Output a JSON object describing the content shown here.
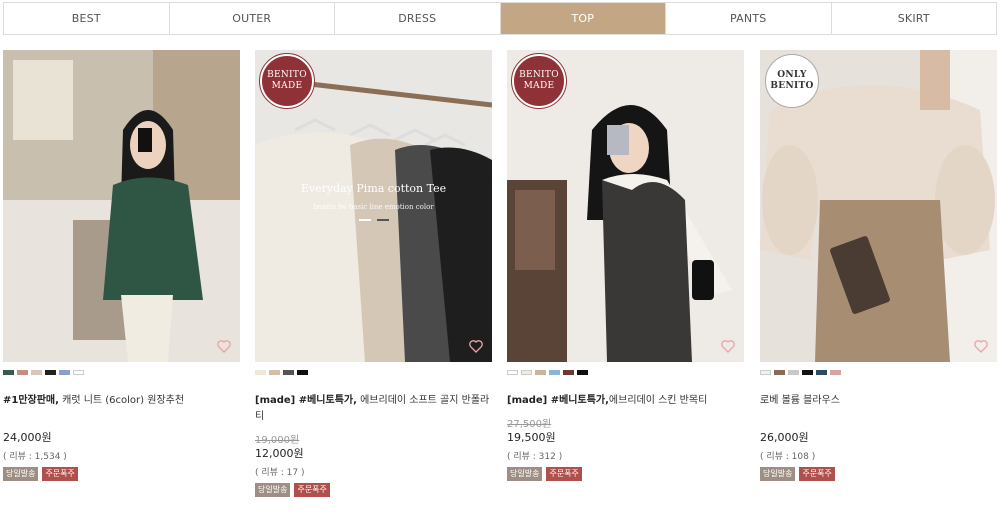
{
  "tabs": [
    {
      "label": "BEST"
    },
    {
      "label": "OUTER"
    },
    {
      "label": "DRESS"
    },
    {
      "label": "TOP",
      "active": true
    },
    {
      "label": "PANTS"
    },
    {
      "label": "SKIRT"
    }
  ],
  "products": [
    {
      "title_bold": "#1만장판매,",
      "title_rest": " 캐럿 니트 (6color) 원장추천",
      "old_price": "",
      "price": "24,000원",
      "reviews": "( 리뷰 : 1,534 )",
      "tags": [
        "당일발송",
        "주문폭주"
      ],
      "swatches": [
        "#3a5b4b",
        "#c98c80",
        "#d8c7b8",
        "#222222",
        "#8aa0c8",
        "#ffffff"
      ]
    },
    {
      "badge": [
        "BENITO",
        "MADE"
      ],
      "title_bold": "[made] #베니토특가,",
      "title_rest": " 에브리데이 소프트 골지 반폴라티",
      "old_price": "19,000원",
      "price": "12,000원",
      "reviews": "( 리뷰 : 17 )",
      "tags": [
        "당일발송",
        "주문폭주"
      ],
      "swatches": [
        "#f1e7d9",
        "#d3bfa9",
        "#555555",
        "#111111"
      ],
      "image_text": {
        "line1": "Everyday  Pima cotton Tee",
        "line2": "benito fw basic line emotion color"
      }
    },
    {
      "badge": [
        "BENITO",
        "MADE"
      ],
      "title_bold": "[made] #베니토특가,",
      "title_rest": "에브리데이 스킨 반목티",
      "old_price": "27,500원",
      "price": "19,500원",
      "reviews": "( 리뷰 : 312 )",
      "tags": [
        "당일발송",
        "주문폭주"
      ],
      "swatches": [
        "#ffffff",
        "#f3ead8",
        "#c9b79c",
        "#8cb4d6",
        "#6b3a2e",
        "#111111"
      ]
    },
    {
      "badge": [
        "ONLY",
        "BENITO"
      ],
      "title_bold": "",
      "title_rest": "로베 볼륨 블라우스",
      "old_price": "",
      "price": "26,000원",
      "reviews": "( 리뷰 : 108 )",
      "tags": [
        "당일발송",
        "주문폭주"
      ],
      "swatches": [
        "#f5efe6",
        "#8a6a55",
        "#c8c8c8",
        "#111111",
        "#2c4a66",
        "#d8a3a0"
      ]
    }
  ]
}
